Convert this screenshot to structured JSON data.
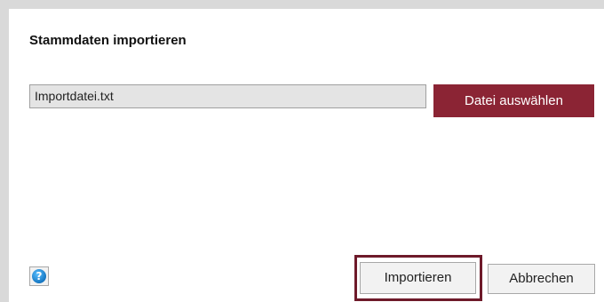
{
  "dialog": {
    "title": "Stammdaten importieren"
  },
  "file_picker": {
    "file_value": "Importdatei.txt",
    "choose_label": "Datei auswählen"
  },
  "footer": {
    "help_icon": "question-circle-icon",
    "help_glyph": "?",
    "import_label": "Importieren",
    "cancel_label": "Abbrechen"
  },
  "colors": {
    "accent": "#8b2434",
    "highlight_border": "#6e1a2a",
    "help_blue": "#1576c2"
  }
}
